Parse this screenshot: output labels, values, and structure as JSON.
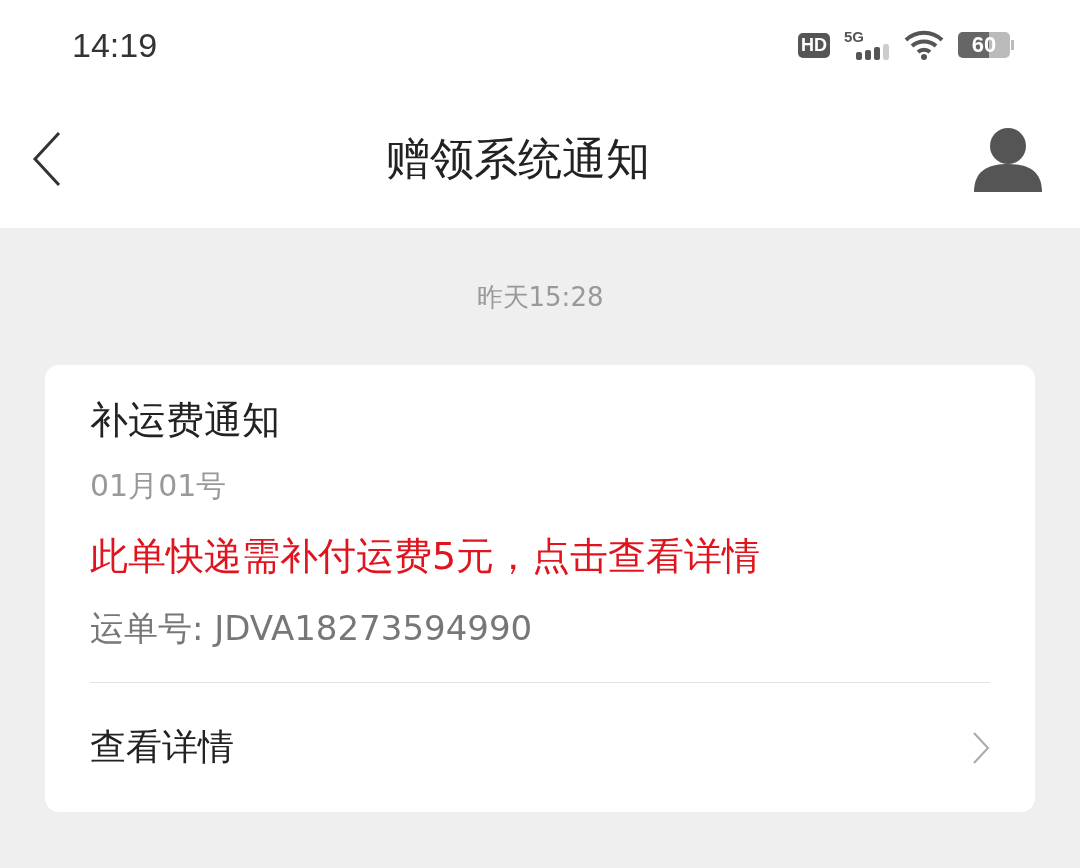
{
  "status_bar": {
    "time": "14:19",
    "hd": "HD",
    "network": "5G",
    "battery": "60"
  },
  "header": {
    "title": "赠领系统通知"
  },
  "message": {
    "timestamp": "昨天15:28",
    "card": {
      "title": "补运费通知",
      "date": "01月01号",
      "alert": "此单快递需补付运费5元，点击查看详情",
      "tracking": "运单号: JDVA18273594990",
      "link": "查看详情"
    }
  }
}
